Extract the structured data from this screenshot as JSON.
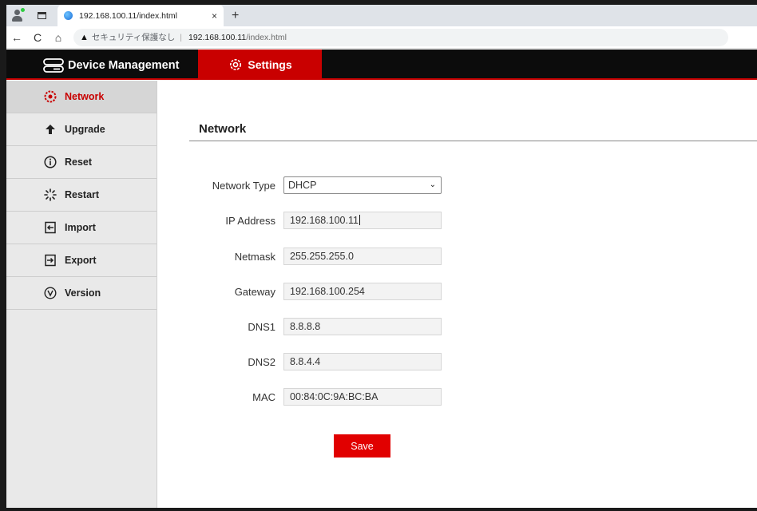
{
  "browser": {
    "tab_title": "192.168.100.11/index.html",
    "tab_close": "×",
    "new_tab": "+",
    "nav_back": "←",
    "nav_reload": "C",
    "nav_home": "⌂",
    "insecure_label": "セキュリティ保護なし",
    "separator": "|",
    "url_host": "192.168.100.11",
    "url_path": "/index.html"
  },
  "header": {
    "brand": "Device Management",
    "settings_tab": "Settings",
    "bg_color": "#0c0c0c",
    "accent_color": "#c90000"
  },
  "sidebar": {
    "items": [
      {
        "label": "Network",
        "icon": "network-icon",
        "active": true
      },
      {
        "label": "Upgrade",
        "icon": "upgrade-icon",
        "active": false
      },
      {
        "label": "Reset",
        "icon": "info-icon",
        "active": false
      },
      {
        "label": "Restart",
        "icon": "spinner-icon",
        "active": false
      },
      {
        "label": "Import",
        "icon": "import-icon",
        "active": false
      },
      {
        "label": "Export",
        "icon": "export-icon",
        "active": false
      },
      {
        "label": "Version",
        "icon": "version-icon",
        "active": false
      }
    ]
  },
  "main": {
    "title": "Network",
    "fields": {
      "network_type": {
        "label": "Network Type",
        "value": "DHCP"
      },
      "ip": {
        "label": "IP Address",
        "value": "192.168.100.11"
      },
      "netmask": {
        "label": "Netmask",
        "value": "255.255.255.0"
      },
      "gateway": {
        "label": "Gateway",
        "value": "192.168.100.254"
      },
      "dns1": {
        "label": "DNS1",
        "value": "8.8.8.8"
      },
      "dns2": {
        "label": "DNS2",
        "value": "8.8.4.4"
      },
      "mac": {
        "label": "MAC",
        "value": "00:84:0C:9A:BC:BA"
      }
    },
    "save_label": "Save"
  }
}
